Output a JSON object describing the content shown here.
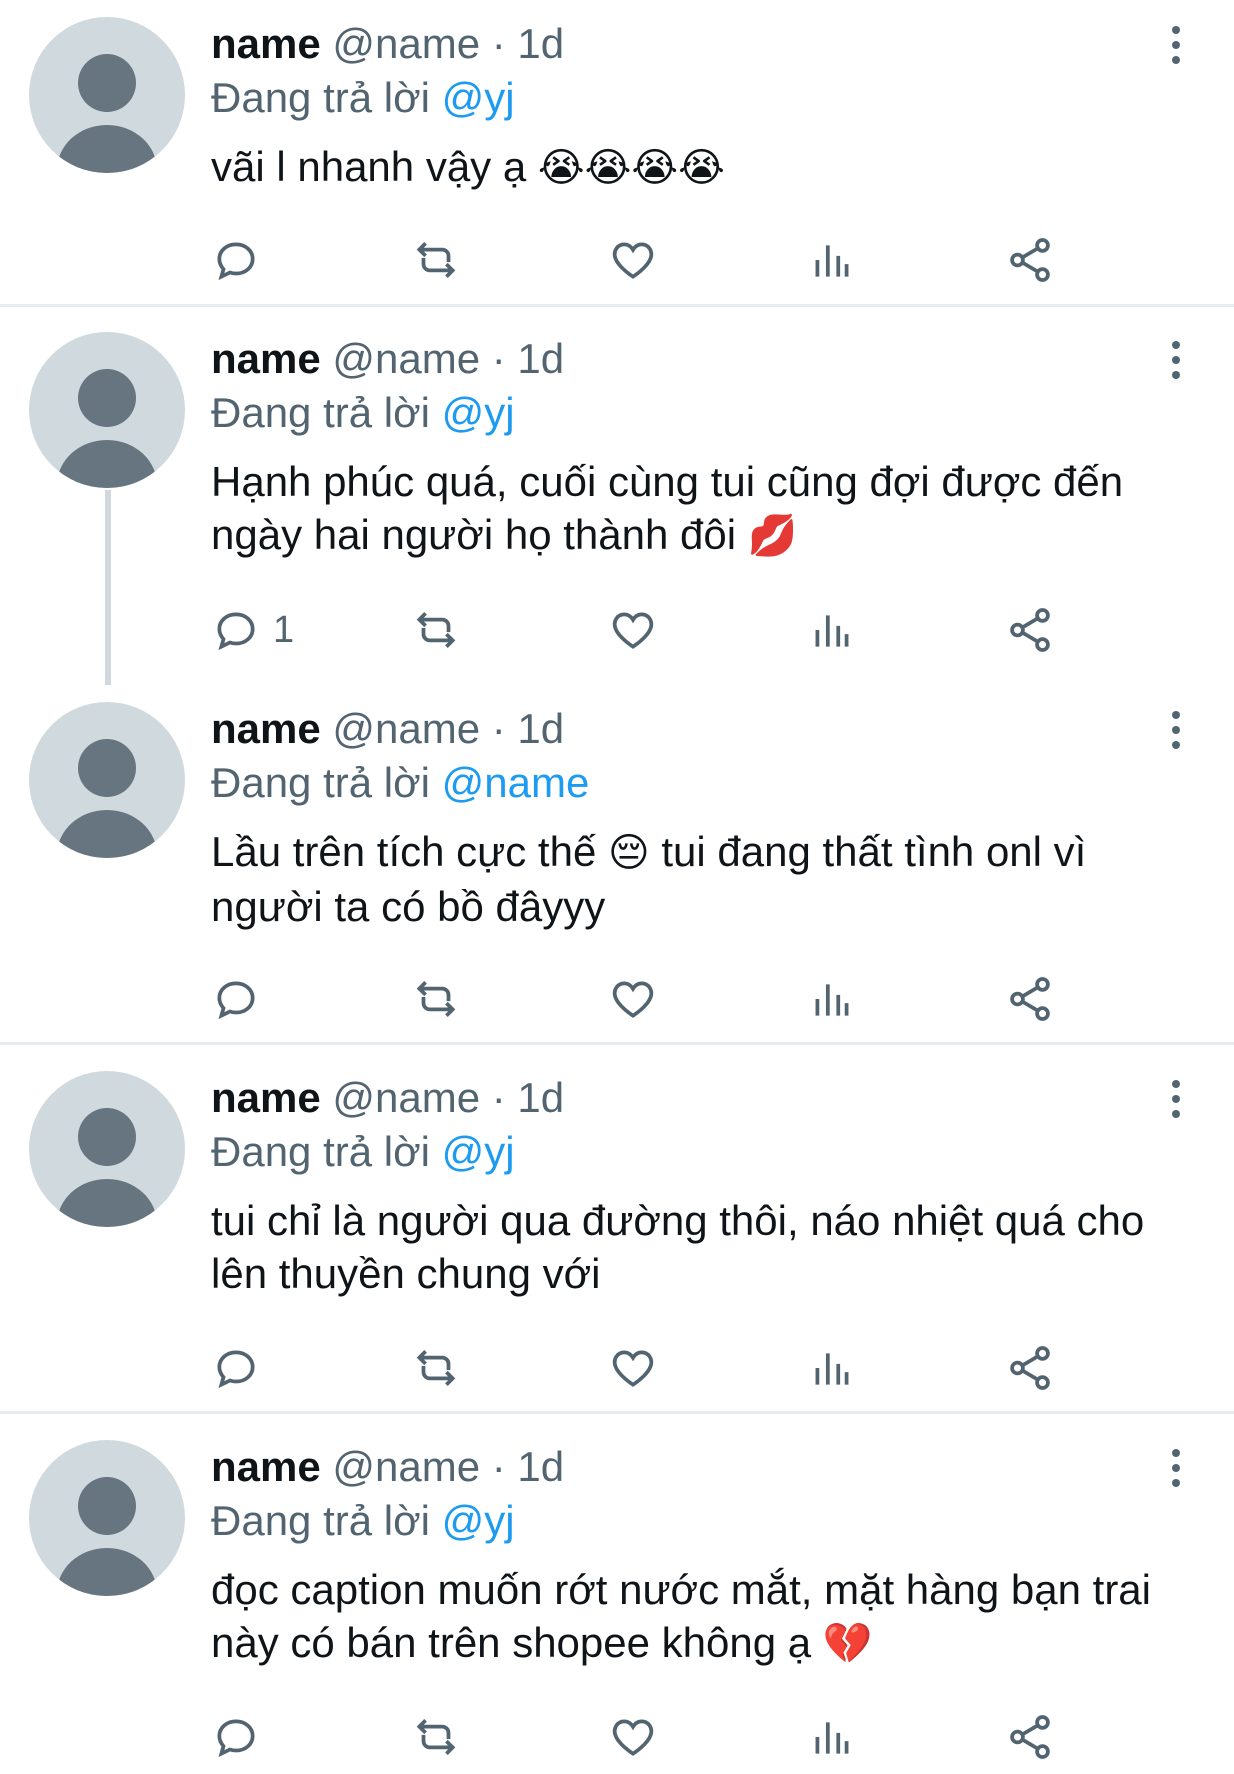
{
  "tweets": [
    {
      "name": "name",
      "handle": "@name",
      "time": "· 1d",
      "replying_prefix": "Đang trả lời",
      "replying_to": "@yj",
      "text": "vãi l nhanh vậy ạ",
      "emoji": "😭😭😭😭",
      "reply_count": ""
    },
    {
      "name": "name",
      "handle": "@name",
      "time": "· 1d",
      "replying_prefix": "Đang trả lời",
      "replying_to": "@yj",
      "text": "Hạnh phúc quá, cuối cùng tui cũng đợi được đến ngày hai người họ thành đôi",
      "emoji": "💋",
      "reply_count": "1"
    },
    {
      "name": "name",
      "handle": "@name",
      "time": "· 1d",
      "replying_prefix": "Đang trả lời",
      "replying_to": "@name",
      "text_before": "Lầu trên tích cực thế",
      "emoji": "😔",
      "text_after": "tui đang thất tình onl vì người ta có bồ đâyyy",
      "reply_count": ""
    },
    {
      "name": "name",
      "handle": "@name",
      "time": "· 1d",
      "replying_prefix": "Đang trả lời",
      "replying_to": "@yj",
      "text": "tui chỉ là người qua đường thôi, náo nhiệt quá cho lên thuyền chung với",
      "emoji": "",
      "reply_count": ""
    },
    {
      "name": "name",
      "handle": "@name",
      "time": "· 1d",
      "replying_prefix": "Đang trả lời",
      "replying_to": "@yj",
      "text": "đọc caption muốn rớt nước mắt, mặt hàng bạn trai này có bán trên shopee không ạ",
      "emoji": "💔",
      "reply_count": ""
    }
  ],
  "icons": {
    "reply": "reply-icon",
    "retweet": "retweet-icon",
    "like": "heart-icon",
    "views": "views-icon",
    "share": "share-icon",
    "more": "more-vertical-icon"
  },
  "colors": {
    "mention": "#1d9bf0",
    "muted": "#536471",
    "avatar_bg": "#cfd9de"
  }
}
